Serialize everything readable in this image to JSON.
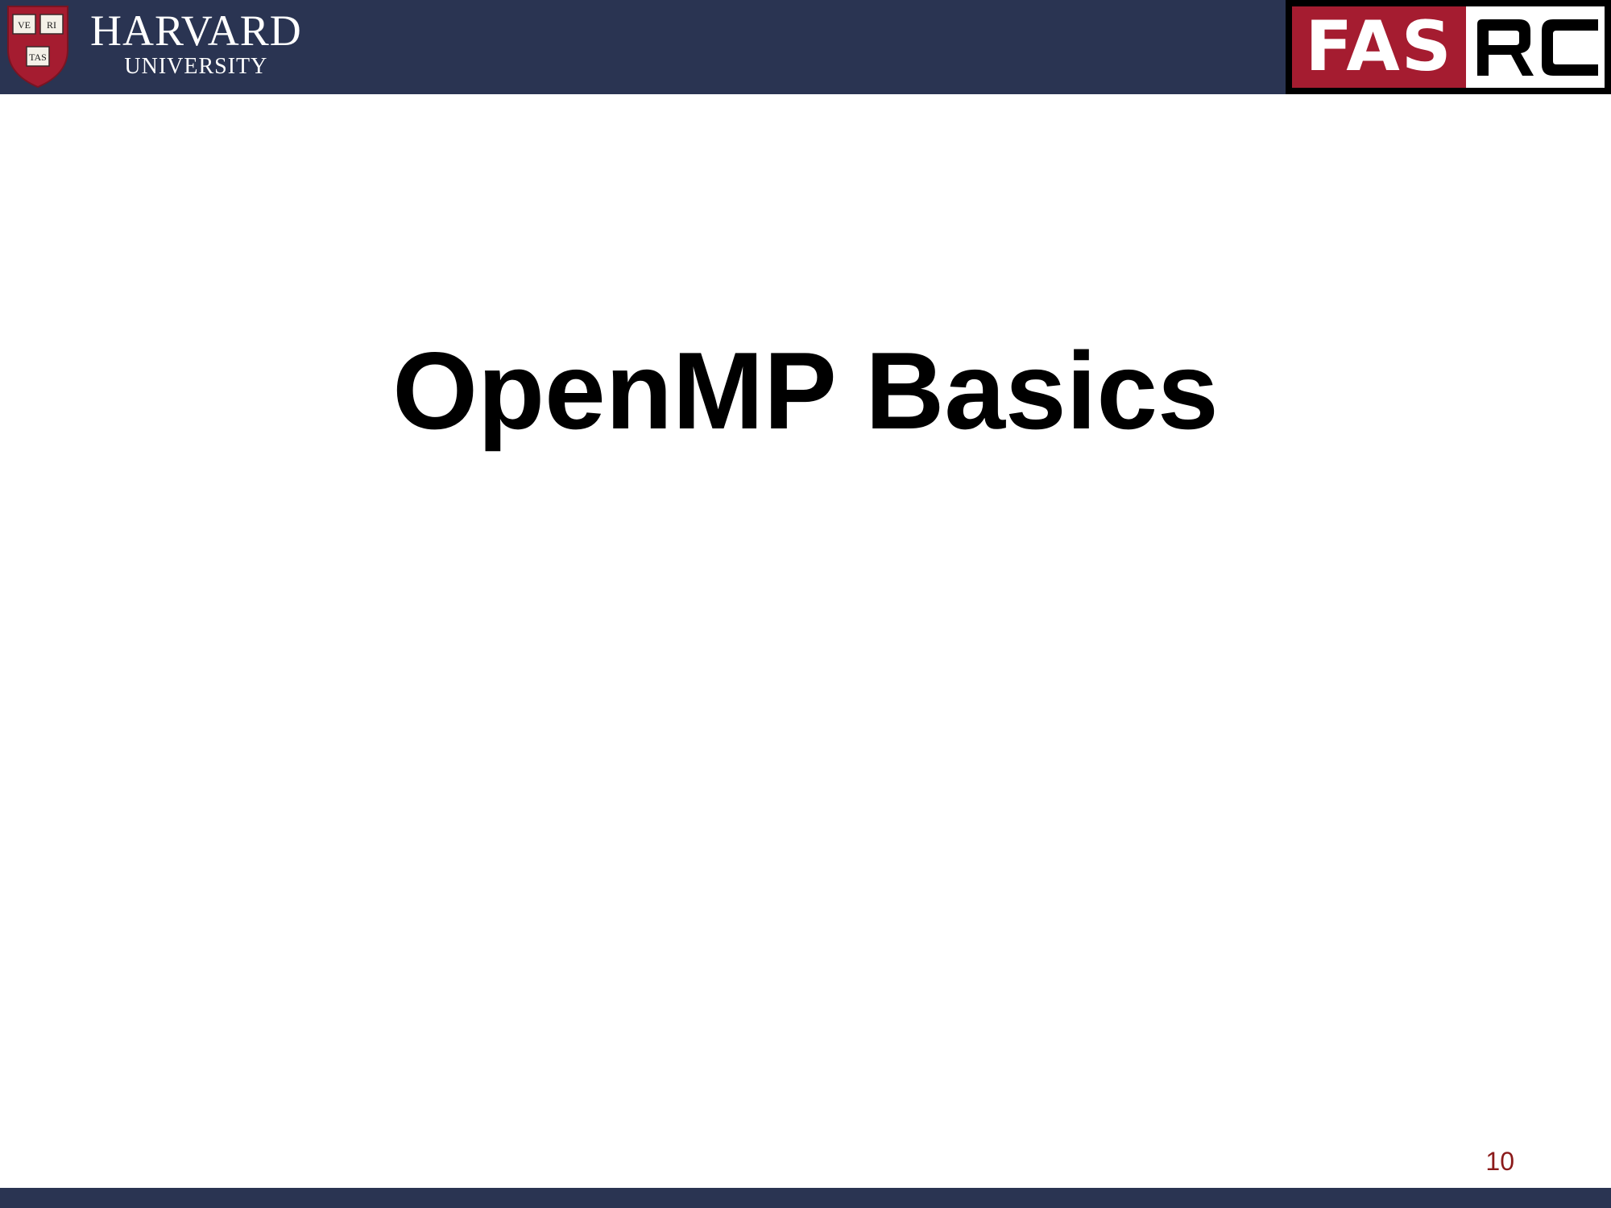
{
  "header": {
    "harvard_logo": {
      "name": "HARVARD",
      "sub": "UNIVERSITY",
      "shield_text": [
        "VE",
        "RI",
        "TAS"
      ]
    },
    "fasrc_logo": {
      "red_text": "FAS",
      "white_text": "RC"
    }
  },
  "slide": {
    "title": "OpenMP Basics",
    "page_number": "10"
  },
  "colors": {
    "band": "#2a3452",
    "harvard_crimson": "#a51c30",
    "page_number": "#8b1a1a"
  }
}
